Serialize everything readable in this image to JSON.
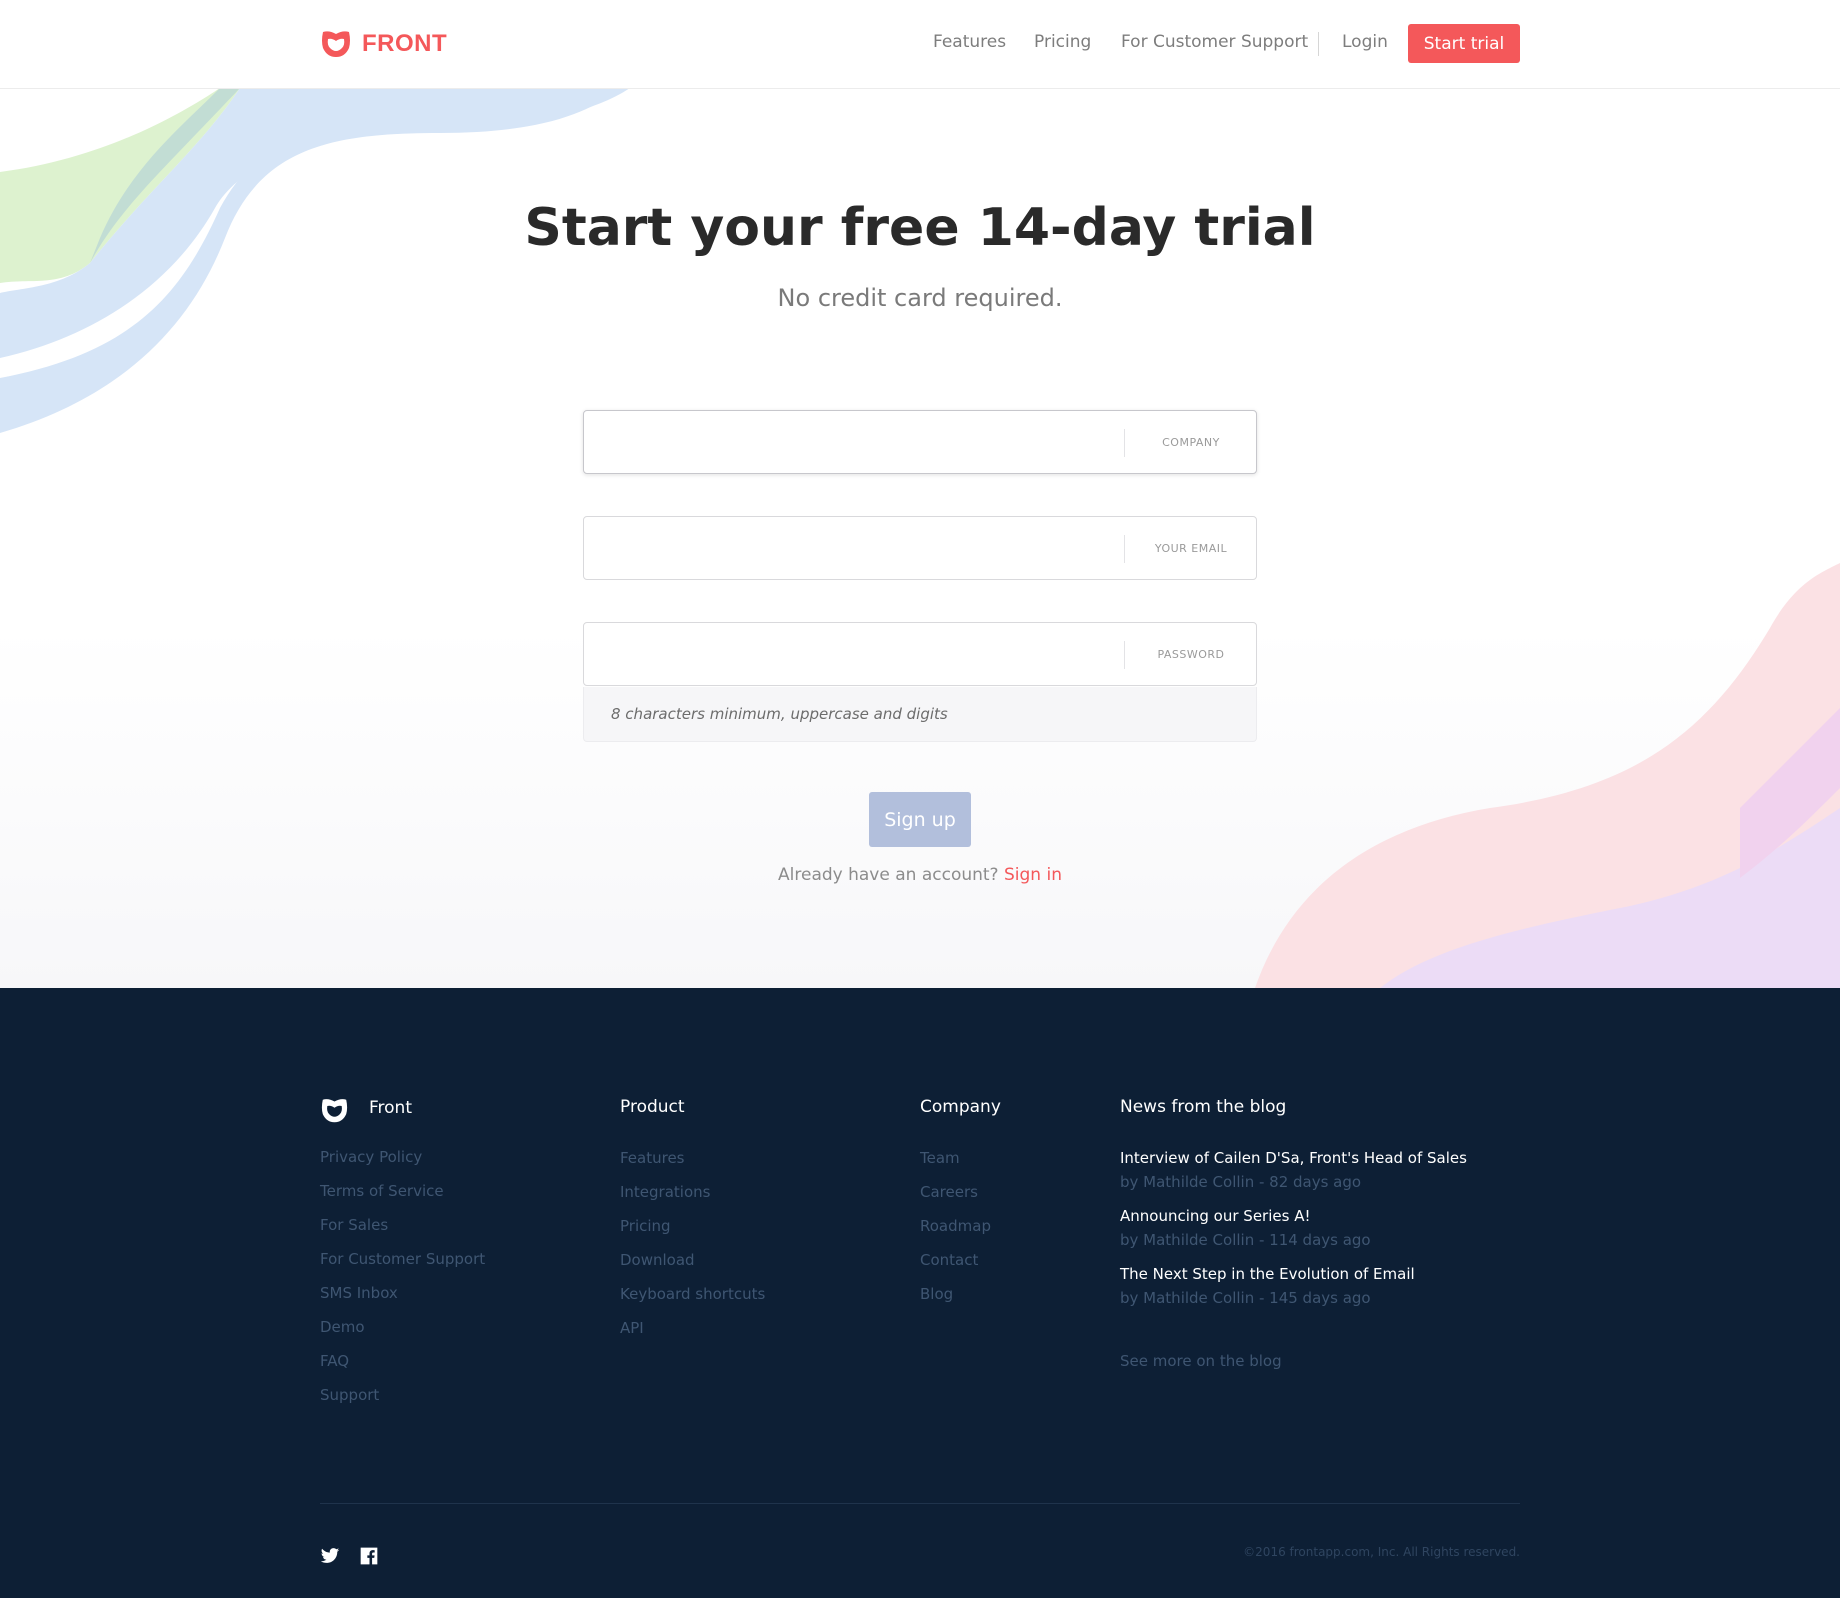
{
  "brand": {
    "name": "FRONT",
    "accent": "#f4585a"
  },
  "nav": {
    "features": "Features",
    "pricing": "Pricing",
    "customer_support": "For Customer Support",
    "login": "Login",
    "start_trial": "Start trial"
  },
  "hero": {
    "title": "Start your free 14-day trial",
    "subtitle": "No credit card required."
  },
  "form": {
    "company": {
      "label": "COMPANY",
      "value": ""
    },
    "email": {
      "label": "YOUR EMAIL",
      "value": ""
    },
    "password": {
      "label": "PASSWORD",
      "value": ""
    },
    "password_hint": "8 characters minimum, uppercase and digits",
    "signup_label": "Sign up",
    "already_text": "Already have an account?",
    "signin_label": "Sign in"
  },
  "footer": {
    "brand_name": "Front",
    "col1": [
      "Privacy Policy",
      "Terms of Service",
      "For Sales",
      "For Customer Support",
      "SMS Inbox",
      "Demo",
      "FAQ",
      "Support"
    ],
    "product": {
      "heading": "Product",
      "links": [
        "Features",
        "Integrations",
        "Pricing",
        "Download",
        "Keyboard shortcuts",
        "API"
      ]
    },
    "company": {
      "heading": "Company",
      "links": [
        "Team",
        "Careers",
        "Roadmap",
        "Contact",
        "Blog"
      ]
    },
    "blog": {
      "heading": "News from the blog",
      "posts": [
        {
          "title": "Interview of Cailen D'Sa, Front's Head of Sales",
          "meta": "by Mathilde Collin - 82 days ago"
        },
        {
          "title": "Announcing our Series A!",
          "meta": "by Mathilde Collin - 114 days ago"
        },
        {
          "title": "The Next Step in the Evolution of Email",
          "meta": "by Mathilde Collin - 145 days ago"
        }
      ],
      "see_more": "See more on the blog"
    },
    "social": [
      "twitter-icon",
      "facebook-icon"
    ],
    "copyright": "©2016 frontapp.com, Inc. All Rights reserved."
  }
}
